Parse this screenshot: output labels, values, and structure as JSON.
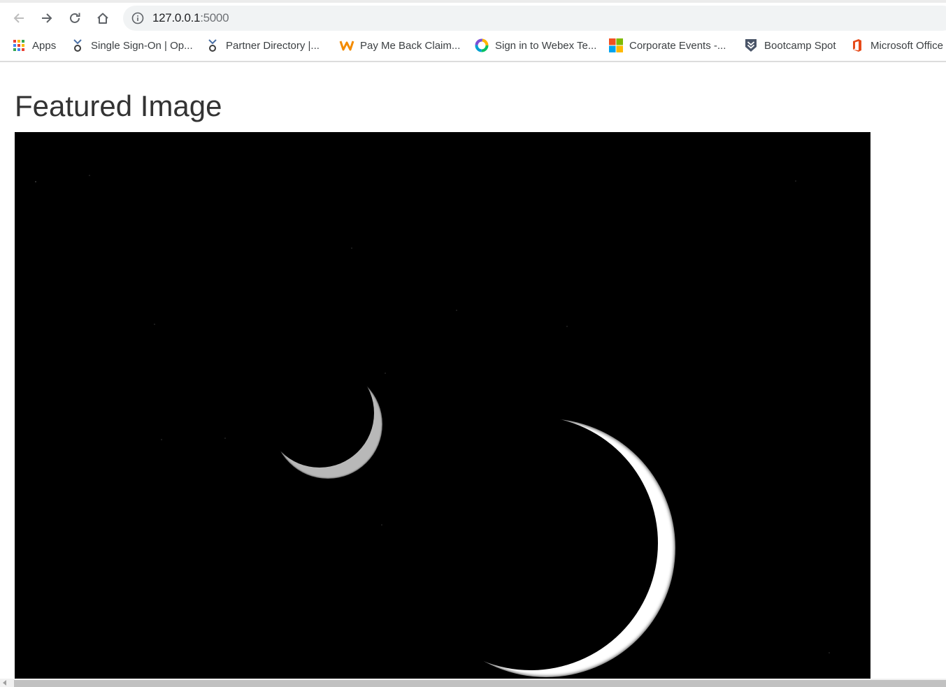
{
  "browser": {
    "address": {
      "host": "127.0.0.1",
      "port": ":5000"
    },
    "nav": {
      "back": "arrow-left-icon",
      "forward": "arrow-right-icon",
      "reload": "reload-icon",
      "home": "home-icon"
    }
  },
  "bookmarks": [
    {
      "label": "Apps",
      "icon": "apps-grid-icon"
    },
    {
      "label": "Single Sign-On | Op...",
      "icon": "okta-icon"
    },
    {
      "label": "Partner Directory |...",
      "icon": "okta-icon"
    },
    {
      "label": "Pay Me Back Claim...",
      "icon": "workday-icon"
    },
    {
      "label": "Sign in to Webex Te...",
      "icon": "webex-icon"
    },
    {
      "label": "Corporate Events -...",
      "icon": "microsoft-icon"
    },
    {
      "label": "Bootcamp Spot",
      "icon": "shield-chevron-icon"
    },
    {
      "label": "Microsoft Office",
      "icon": "office-icon"
    }
  ],
  "page": {
    "title": "Featured Image",
    "image": "crescent-moons-space-image"
  },
  "colors": {
    "toolbar_bg": "#ffffff",
    "omnibox_bg": "#f1f3f4",
    "title_text": "#333333",
    "image_bg": "#000000"
  }
}
